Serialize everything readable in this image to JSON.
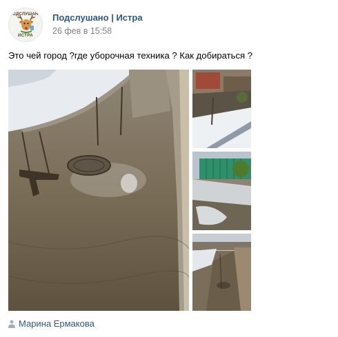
{
  "post": {
    "author": "Подслушано | Истра",
    "date": "26 фев в 15:58",
    "text": "Это чей город ?где уборочная техника ? Как добираться ?",
    "avatar": {
      "top_text": "ПОДСЛУШАНО",
      "bottom_text": "ИСТРА",
      "icon": "deer-icon"
    },
    "photos": [
      {
        "name": "flooded-sidewalk-with-manhole"
      },
      {
        "name": "snowy-street-with-fence"
      },
      {
        "name": "slushy-path-with-green-fence"
      },
      {
        "name": "flooded-road-with-snow-banks"
      }
    ],
    "signer": {
      "name": "Марина Ермакова",
      "icon": "person-icon"
    }
  },
  "colors": {
    "link": "#2a5885",
    "meta": "#828282",
    "text": "#000000",
    "background": "#ffffff"
  }
}
